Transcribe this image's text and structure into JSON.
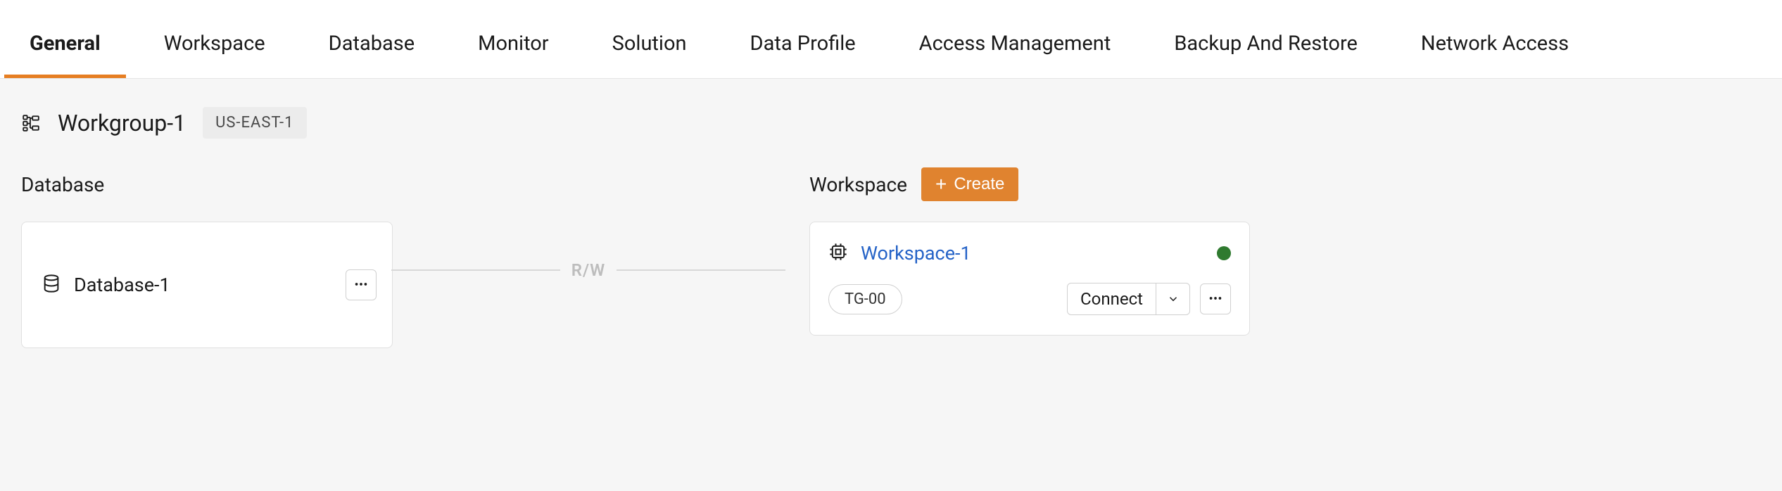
{
  "tabs": [
    {
      "label": "General",
      "active": true
    },
    {
      "label": "Workspace",
      "active": false
    },
    {
      "label": "Database",
      "active": false
    },
    {
      "label": "Monitor",
      "active": false
    },
    {
      "label": "Solution",
      "active": false
    },
    {
      "label": "Data Profile",
      "active": false
    },
    {
      "label": "Access Management",
      "active": false
    },
    {
      "label": "Backup And Restore",
      "active": false
    },
    {
      "label": "Network Access",
      "active": false
    }
  ],
  "workgroup": {
    "name": "Workgroup-1",
    "region": "US-EAST-1"
  },
  "database_section": {
    "title": "Database",
    "card": {
      "name": "Database-1"
    }
  },
  "workspace_section": {
    "title": "Workspace",
    "create_label": "Create",
    "card": {
      "name": "Workspace-1",
      "tag": "TG-00",
      "connect_label": "Connect",
      "status": "online"
    }
  },
  "connector": {
    "label": "R/W"
  }
}
